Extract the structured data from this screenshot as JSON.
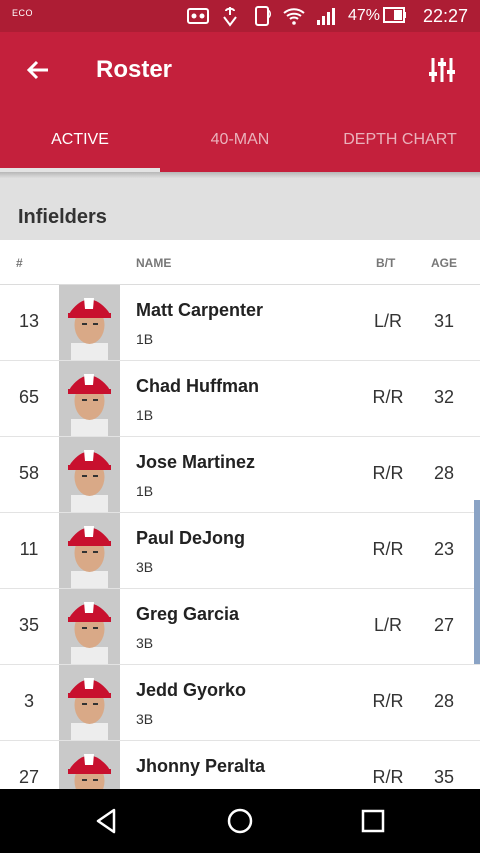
{
  "status_bar": {
    "eco_label": "ECO",
    "battery_percent": "47%",
    "time": "22:27",
    "icons": [
      "vr-icon",
      "touch-icon",
      "nfc-icon",
      "wifi-icon",
      "signal-icon",
      "battery-icon"
    ]
  },
  "app_bar": {
    "title": "Roster",
    "back_icon": "arrow-left-icon",
    "filter_icon": "sliders-icon"
  },
  "tabs": [
    {
      "label": "ACTIVE",
      "active": true
    },
    {
      "label": "40-MAN",
      "active": false
    },
    {
      "label": "DEPTH CHART",
      "active": false
    }
  ],
  "section": {
    "title": "Infielders"
  },
  "columns": {
    "number": "#",
    "name": "NAME",
    "bt": "B/T",
    "age": "AGE"
  },
  "players": [
    {
      "number": "13",
      "name": "Matt Carpenter",
      "position": "1B",
      "bt": "L/R",
      "age": "31"
    },
    {
      "number": "65",
      "name": "Chad Huffman",
      "position": "1B",
      "bt": "R/R",
      "age": "32"
    },
    {
      "number": "58",
      "name": "Jose Martinez",
      "position": "1B",
      "bt": "R/R",
      "age": "28"
    },
    {
      "number": "11",
      "name": "Paul DeJong",
      "position": "3B",
      "bt": "R/R",
      "age": "23"
    },
    {
      "number": "35",
      "name": "Greg Garcia",
      "position": "3B",
      "bt": "L/R",
      "age": "27"
    },
    {
      "number": "3",
      "name": "Jedd Gyorko",
      "position": "3B",
      "bt": "R/R",
      "age": "28"
    },
    {
      "number": "27",
      "name": "Jhonny Peralta",
      "position": "3B",
      "bt": "R/R",
      "age": "35"
    }
  ],
  "nav": {
    "back": "back-triangle-icon",
    "home": "home-circle-icon",
    "recents": "recents-square-icon"
  },
  "colors": {
    "status_bar": "#ad1d34",
    "app_bar": "#c4203c",
    "section_bg": "#e0e0e0",
    "cap_red": "#c8102e"
  }
}
